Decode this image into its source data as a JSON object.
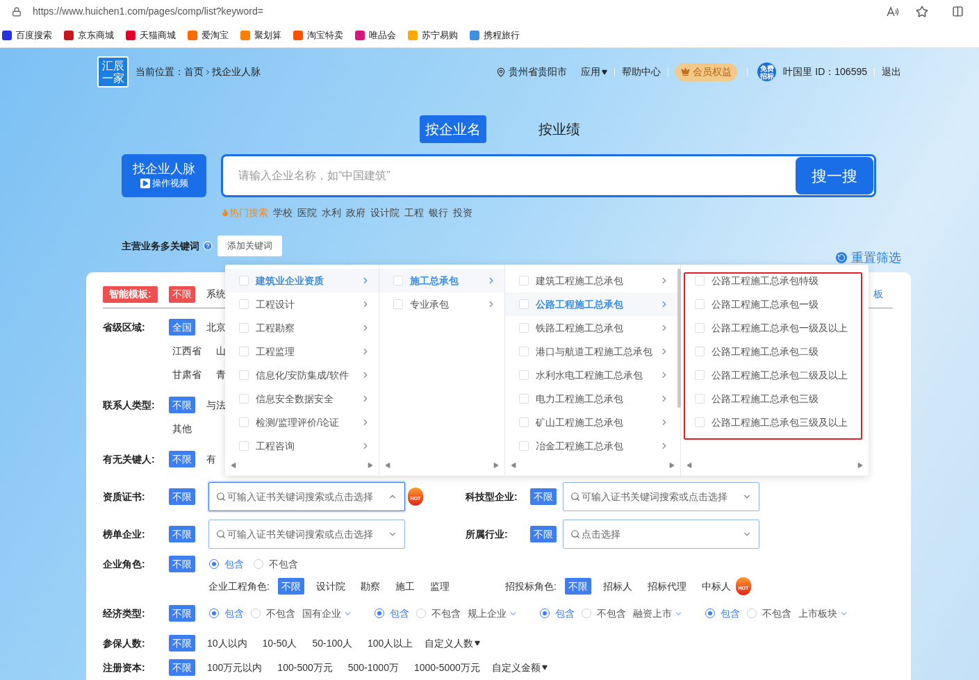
{
  "browser": {
    "url": "https://www.huichen1.com/pages/comp/list?keyword=",
    "bookmarks": [
      {
        "label": "百度搜索",
        "color": "#2932e1"
      },
      {
        "label": "京东商城",
        "color": "#c8161d"
      },
      {
        "label": "天猫商城",
        "color": "#e4002b"
      },
      {
        "label": "爱淘宝",
        "color": "#ff6a00"
      },
      {
        "label": "聚划算",
        "color": "#ff7e00"
      },
      {
        "label": "淘宝特卖",
        "color": "#ff5000"
      },
      {
        "label": "唯品会",
        "color": "#d8177e"
      },
      {
        "label": "苏宁易购",
        "color": "#ffaa00"
      },
      {
        "label": "携程旅行",
        "color": "#3d8fe0"
      }
    ]
  },
  "header": {
    "logo": [
      "汇辰",
      "一家"
    ],
    "breadcrumb_label": "当前位置：",
    "breadcrumb": [
      "首页",
      "找企业人脉"
    ],
    "location": "贵州省贵阳市",
    "apps": "应用",
    "help": "帮助中心",
    "vip": "会员权益",
    "avatar_text": [
      "免费",
      "招标"
    ],
    "user": "叶国里 ID：106595",
    "logout": "退出"
  },
  "search_tabs": [
    {
      "label": "按企业名",
      "selected": true
    },
    {
      "label": "按业绩",
      "selected": false
    }
  ],
  "search": {
    "side_title": "找企业人脉",
    "side_sub": "操作视频",
    "placeholder": "请输入企业名称，如“中国建筑”",
    "button": "搜一搜"
  },
  "hot": {
    "label": "热门搜索",
    "terms": [
      "学校",
      "医院",
      "水利",
      "政府",
      "设计院",
      "工程",
      "银行",
      "投资"
    ]
  },
  "keywords": {
    "label": "主营业务多关键词",
    "button": "添加关键词"
  },
  "reset": "重置筛选",
  "filters": {
    "template": {
      "label": "智能模板:",
      "options": [
        {
          "label": "不限",
          "selected": true
        },
        {
          "label": "系统",
          "selected": false
        }
      ],
      "right_text": "板"
    },
    "region": {
      "label": "省级区域:",
      "lines": [
        [
          {
            "label": "全国",
            "selected": true
          },
          {
            "label": "北京",
            "selected": false
          }
        ],
        [
          {
            "label": "江西省",
            "selected": false
          },
          {
            "label": "山",
            "selected": false
          }
        ],
        [
          {
            "label": "甘肃省",
            "selected": false
          },
          {
            "label": "青",
            "selected": false
          }
        ]
      ]
    },
    "contact_type": {
      "label": "联系人类型:",
      "lines": [
        [
          {
            "label": "不限",
            "selected": true
          },
          {
            "label": "与法",
            "selected": false
          }
        ],
        [
          {
            "label": "其他",
            "selected": false
          }
        ]
      ]
    },
    "key_person": {
      "label": "有无关键人:",
      "lines": [
        [
          {
            "label": "不限",
            "selected": true
          },
          {
            "label": "有",
            "selected": false
          }
        ]
      ]
    },
    "select_rows": [
      [
        {
          "label": "资质证书:",
          "any": {
            "label": "不限",
            "selected": true
          },
          "placeholder": "可输入证书关键词搜索或点击选择",
          "expanded": true,
          "hot": "HOT"
        },
        {
          "label": "科技型企业:",
          "any": {
            "label": "不限",
            "selected": true
          },
          "placeholder": "可输入证书关键词搜索或点击选择",
          "expanded": false
        }
      ],
      [
        {
          "label": "榜单企业:",
          "any": {
            "label": "不限",
            "selected": true
          },
          "placeholder": "可输入证书关键词搜索或点击选择",
          "expanded": false
        },
        {
          "label": "所属行业:",
          "any": {
            "label": "不限",
            "selected": true
          },
          "placeholder": "点击选择",
          "expanded": false
        }
      ]
    ],
    "company_role": {
      "label": "企业角色:",
      "any": {
        "label": "不限",
        "selected": true
      },
      "radios": [
        {
          "label": "包含",
          "selected": true
        },
        {
          "label": "不包含",
          "selected": false
        }
      ],
      "groups": [
        {
          "label": "企业工程角色:",
          "options": [
            {
              "label": "不限",
              "selected": true
            },
            {
              "label": "设计院",
              "selected": false
            },
            {
              "label": "勘察",
              "selected": false
            },
            {
              "label": "施工",
              "selected": false
            },
            {
              "label": "监理",
              "selected": false
            }
          ]
        },
        {
          "label": "招投标角色:",
          "options": [
            {
              "label": "不限",
              "selected": true
            },
            {
              "label": "招标人",
              "selected": false
            },
            {
              "label": "招标代理",
              "selected": false
            },
            {
              "label": "中标人",
              "selected": false
            }
          ],
          "hot": "HOT"
        }
      ]
    },
    "economy": {
      "label": "经济类型:",
      "any": {
        "label": "不限",
        "selected": true
      },
      "groups": [
        {
          "radios": [
            {
              "label": "包含",
              "selected": true
            },
            {
              "label": "不包含",
              "selected": false
            }
          ],
          "select": "国有企业"
        },
        {
          "radios": [
            {
              "label": "包含",
              "selected": true
            },
            {
              "label": "不包含",
              "selected": false
            }
          ],
          "select": "规上企业"
        },
        {
          "radios": [
            {
              "label": "包含",
              "selected": true
            },
            {
              "label": "不包含",
              "selected": false
            }
          ],
          "select": "融资上市"
        },
        {
          "radios": [
            {
              "label": "包含",
              "selected": true
            },
            {
              "label": "不包含",
              "selected": false
            }
          ],
          "select": "上市板块"
        }
      ]
    },
    "insured": {
      "label": "参保人数:",
      "options": [
        {
          "label": "不限",
          "selected": true
        },
        {
          "label": "10人以内",
          "selected": false
        },
        {
          "label": "10-50人",
          "selected": false
        },
        {
          "label": "50-100人",
          "selected": false
        },
        {
          "label": "100人以上",
          "selected": false
        }
      ],
      "custom": "自定义人数"
    },
    "capital": {
      "label": "注册资本:",
      "options": [
        {
          "label": "不限",
          "selected": true
        },
        {
          "label": "100万元以内",
          "selected": false
        },
        {
          "label": "100-500万元",
          "selected": false
        },
        {
          "label": "500-1000万",
          "selected": false
        },
        {
          "label": "1000-5000万元",
          "selected": false
        }
      ],
      "custom": "自定义金额"
    }
  },
  "dropdown": {
    "columns": [
      {
        "items": [
          {
            "label": "建筑业企业资质",
            "selected": true,
            "checked": false,
            "has_children": true
          },
          {
            "label": "工程设计",
            "selected": false,
            "checked": false,
            "has_children": true
          },
          {
            "label": "工程勘察",
            "selected": false,
            "checked": false,
            "has_children": true
          },
          {
            "label": "工程监理",
            "selected": false,
            "checked": false,
            "has_children": true
          },
          {
            "label": "信息化/安防集成/软件",
            "selected": false,
            "checked": false,
            "has_children": true
          },
          {
            "label": "信息安全数据安全",
            "selected": false,
            "checked": false,
            "has_children": true
          },
          {
            "label": "检测/监理评价/论证",
            "selected": false,
            "checked": false,
            "has_children": true
          },
          {
            "label": "工程咨询",
            "selected": false,
            "checked": false,
            "has_children": true
          }
        ]
      },
      {
        "items": [
          {
            "label": "施工总承包",
            "selected": true,
            "checked": false,
            "has_children": true
          },
          {
            "label": "专业承包",
            "selected": false,
            "checked": false,
            "has_children": true
          }
        ]
      },
      {
        "scrollable": true,
        "items": [
          {
            "label": "建筑工程施工总承包",
            "selected": false,
            "checked": false,
            "has_children": true
          },
          {
            "label": "公路工程施工总承包",
            "selected": true,
            "checked": false,
            "has_children": true
          },
          {
            "label": "铁路工程施工总承包",
            "selected": false,
            "checked": false,
            "has_children": true
          },
          {
            "label": "港口与航道工程施工总承包",
            "selected": false,
            "checked": false,
            "has_children": true
          },
          {
            "label": "水利水电工程施工总承包",
            "selected": false,
            "checked": false,
            "has_children": true
          },
          {
            "label": "电力工程施工总承包",
            "selected": false,
            "checked": false,
            "has_children": true
          },
          {
            "label": "矿山工程施工总承包",
            "selected": false,
            "checked": false,
            "has_children": true
          },
          {
            "label": "冶金工程施工总承包",
            "selected": false,
            "checked": false,
            "has_children": true
          }
        ]
      },
      {
        "highlighted": true,
        "items": [
          {
            "label": "公路工程施工总承包特级",
            "selected": false,
            "checked": false,
            "has_children": false
          },
          {
            "label": "公路工程施工总承包一级",
            "selected": false,
            "checked": false,
            "has_children": false
          },
          {
            "label": "公路工程施工总承包一级及以上",
            "selected": false,
            "checked": false,
            "has_children": false
          },
          {
            "label": "公路工程施工总承包二级",
            "selected": false,
            "checked": false,
            "has_children": false
          },
          {
            "label": "公路工程施工总承包二级及以上",
            "selected": false,
            "checked": false,
            "has_children": false
          },
          {
            "label": "公路工程施工总承包三级",
            "selected": false,
            "checked": false,
            "has_children": false
          },
          {
            "label": "公路工程施工总承包三级及以上",
            "selected": false,
            "checked": false,
            "has_children": false
          }
        ]
      }
    ]
  }
}
